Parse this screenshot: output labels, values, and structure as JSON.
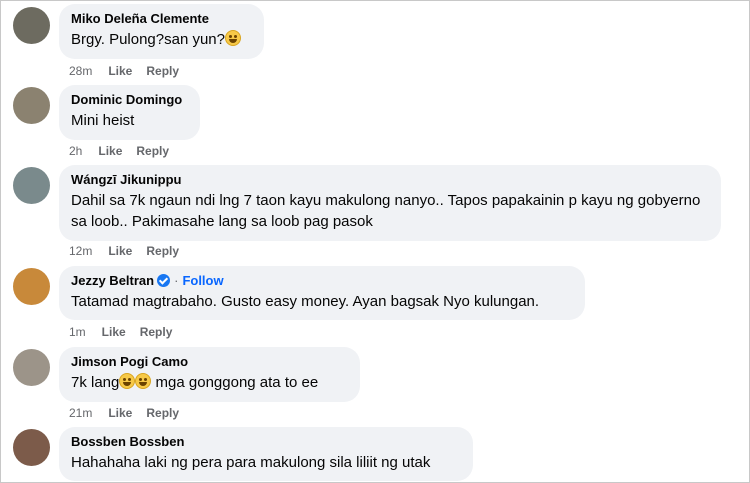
{
  "comments": [
    {
      "name": "Miko Deleña Clemente",
      "text": "Brgy. Pulong?san yun?",
      "emoji_count": 1,
      "time": "28m",
      "like": "Like",
      "reply": "Reply",
      "avatar_color": "#6d6b60"
    },
    {
      "name": "Dominic Domingo",
      "text": "Mini heist",
      "time": "2h",
      "like": "Like",
      "reply": "Reply",
      "avatar_color": "#8b8270"
    },
    {
      "name": "Wángzī Jikunippu",
      "text": "Dahil sa 7k ngaun ndi lng 7 taon kayu makulong nanyo.. Tapos papakainin p kayu ng gobyerno sa loob.. Pakimasahe lang sa loob pag pasok",
      "time": "12m",
      "like": "Like",
      "reply": "Reply",
      "avatar_color": "#7a8a8c"
    },
    {
      "name": "Jezzy Beltran",
      "follow": "Follow",
      "verified": true,
      "text": "Tatamad magtrabaho. Gusto easy money. Ayan bagsak Nyo kulungan.",
      "time": "1m",
      "like": "Like",
      "reply": "Reply",
      "avatar_color": "#c8893a"
    },
    {
      "name": "Jimson Pogi Camo",
      "text": "7k lang",
      "text_after": " mga gonggong ata to ee",
      "time": "21m",
      "like": "Like",
      "reply": "Reply",
      "avatar_color": "#9c9489"
    },
    {
      "name": "Bossben Bossben",
      "text": "Hahahaha laki ng pera para makulong sila liliit ng utak",
      "avatar_color": "#7c5b4a"
    }
  ]
}
